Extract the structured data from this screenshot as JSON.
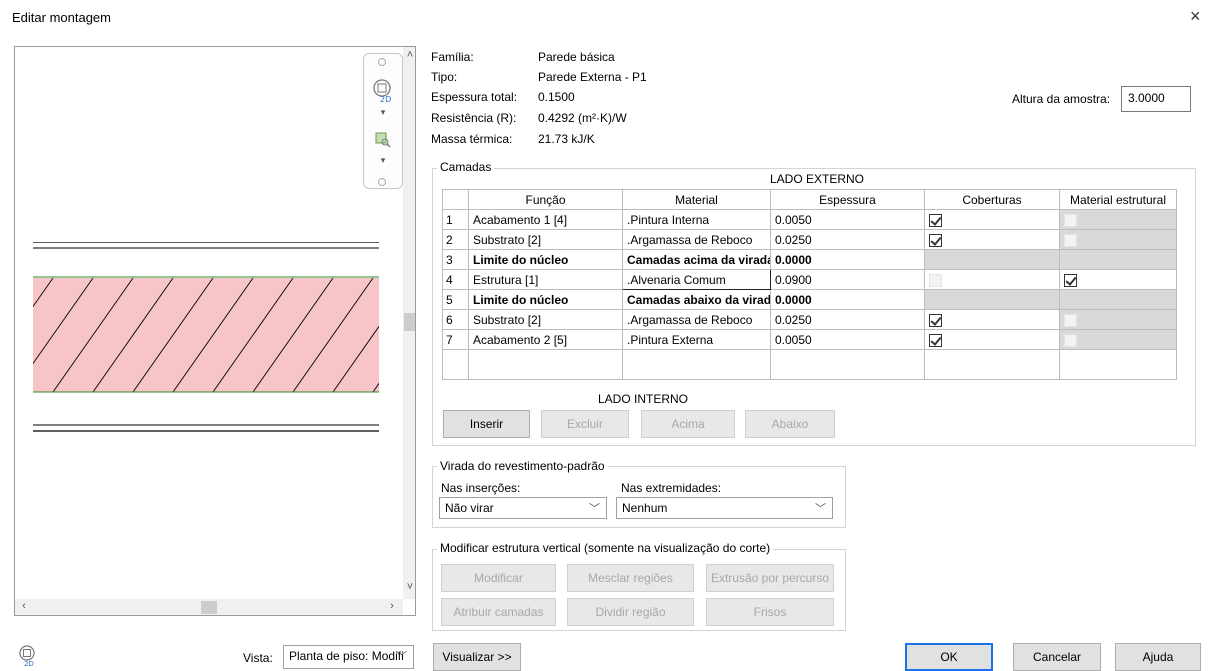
{
  "dialog": {
    "title": "Editar montagem",
    "close_symbol": "×"
  },
  "info": {
    "familia_label": "Família:",
    "familia_value": "Parede básica",
    "tipo_label": "Tipo:",
    "tipo_value": "Parede Externa - P1",
    "espessura_label": "Espessura total:",
    "espessura_value": "0.1500",
    "resistencia_label": "Resistência (R):",
    "resistencia_value": "0.4292 (m²·K)/W",
    "massa_label": "Massa térmica:",
    "massa_value": "21.73 kJ/K",
    "altura_label": "Altura da amostra:",
    "altura_value": "3.0000"
  },
  "layers": {
    "group_title": "Camadas",
    "lado_externo": "LADO EXTERNO",
    "lado_interno": "LADO INTERNO",
    "headers": [
      "Função",
      "Material",
      "Espessura",
      "Coberturas",
      "Material estrutural"
    ],
    "rows": [
      {
        "num": "1",
        "funcao": "Acabamento 1 [4]",
        "material": ".Pintura Interna",
        "espessura": "0.0050",
        "coberturas": true,
        "estrutural": false
      },
      {
        "num": "2",
        "funcao": "Substrato [2]",
        "material": ".Argamassa de Reboco",
        "espessura": "0.0250",
        "coberturas": true,
        "estrutural": false
      },
      {
        "num": "3",
        "funcao": "Limite do núcleo",
        "material": "Camadas acima da virada",
        "espessura": "0.0000"
      },
      {
        "num": "4",
        "funcao": "Estrutura [1]",
        "material": ".Alvenaria Comum",
        "espessura": "0.0900",
        "coberturas": false,
        "estrutural": true
      },
      {
        "num": "5",
        "funcao": "Limite do núcleo",
        "material": "Camadas abaixo da virada",
        "espessura": "0.0000"
      },
      {
        "num": "6",
        "funcao": "Substrato [2]",
        "material": ".Argamassa de Reboco",
        "espessura": "0.0250",
        "coberturas": true,
        "estrutural": false
      },
      {
        "num": "7",
        "funcao": "Acabamento 2 [5]",
        "material": ".Pintura Externa",
        "espessura": "0.0050",
        "coberturas": true,
        "estrutural": false
      }
    ],
    "buttons": {
      "inserir": "Inserir",
      "excluir": "Excluir",
      "acima": "Acima",
      "abaixo": "Abaixo"
    }
  },
  "virada": {
    "group_title": "Virada do revestimento-padrão",
    "insercoes_label": "Nas inserções:",
    "insercoes_value": "Não virar",
    "extremidades_label": "Nas extremidades:",
    "extremidades_value": "Nenhum"
  },
  "vertical": {
    "group_title": "Modificar estrutura vertical (somente na visualização do corte)",
    "modificar": "Modificar",
    "mesclar": "Mesclar regiões",
    "extrusao": "Extrusão por percurso",
    "atribuir": "Atribuir camadas",
    "dividir": "Dividir região",
    "frisos": "Frisos"
  },
  "footer": {
    "vista_label": "Vista:",
    "vista_value": "Planta de piso: Modifi",
    "visualizar": "Visualizar >>",
    "ok": "OK",
    "cancelar": "Cancelar",
    "ajuda": "Ajuda",
    "badge_2d": "2D"
  },
  "colors": {
    "core_fill": "#f7c4c8",
    "core_border": "#2e8b2e",
    "gray_cell": "#d9d9d9",
    "focus": "#1a73e8"
  }
}
